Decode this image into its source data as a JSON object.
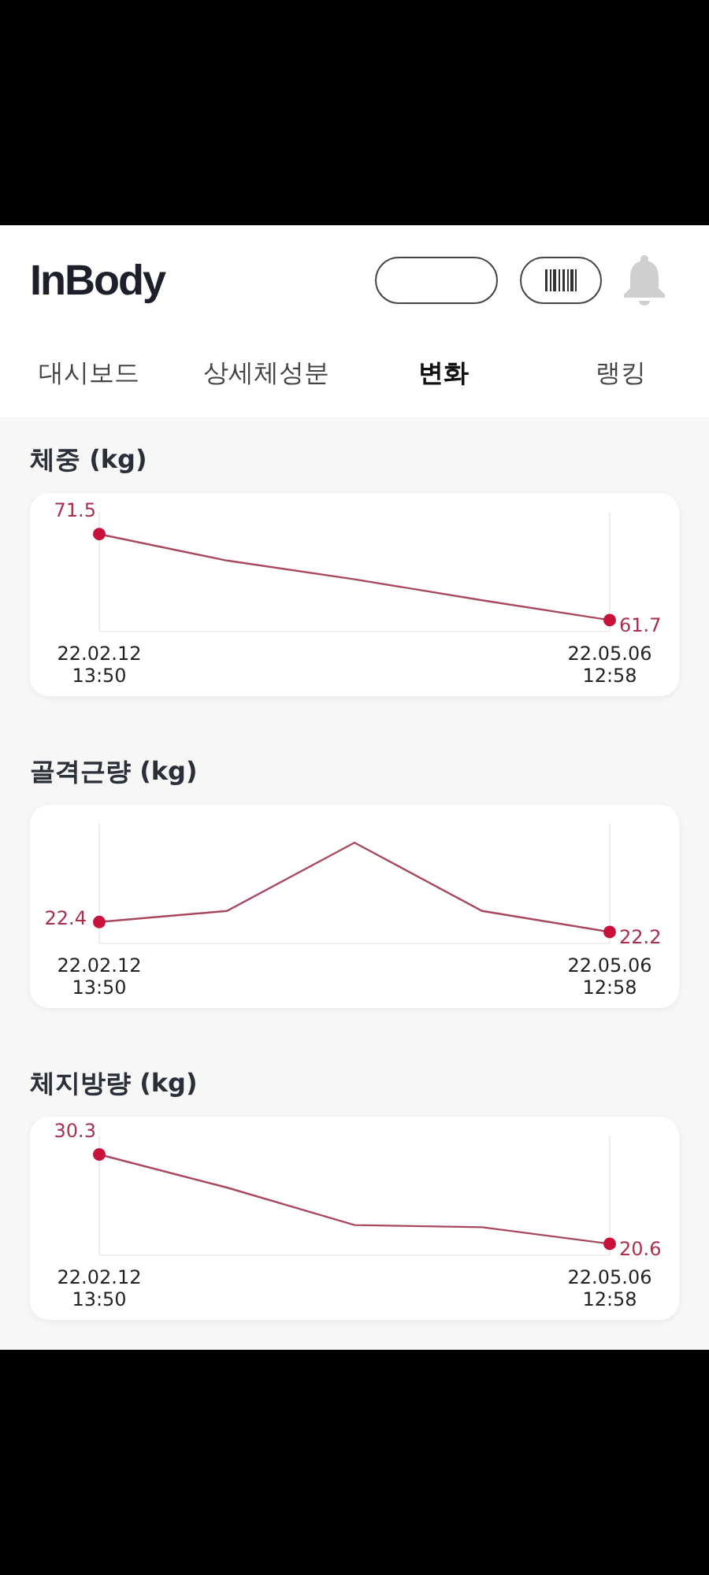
{
  "header": {
    "logo": "InBody"
  },
  "tabs": [
    {
      "label": "대시보드",
      "selected": false
    },
    {
      "label": "상세체성분",
      "selected": false
    },
    {
      "label": "변화",
      "selected": true
    },
    {
      "label": "랭킹",
      "selected": false
    }
  ],
  "sections": [
    {
      "title": "체중 (kg)",
      "start_value": "71.5",
      "end_value": "61.7",
      "start_date": "22.02.12",
      "start_time": "13:50",
      "end_date": "22.05.06",
      "end_time": "12:58"
    },
    {
      "title": "골격근량 (kg)",
      "start_value": "22.4",
      "end_value": "22.2",
      "start_date": "22.02.12",
      "start_time": "13:50",
      "end_date": "22.05.06",
      "end_time": "12:58"
    },
    {
      "title": "체지방량 (kg)",
      "start_value": "30.3",
      "end_value": "20.6",
      "start_date": "22.02.12",
      "start_time": "13:50",
      "end_date": "22.05.06",
      "end_time": "12:58"
    }
  ]
}
